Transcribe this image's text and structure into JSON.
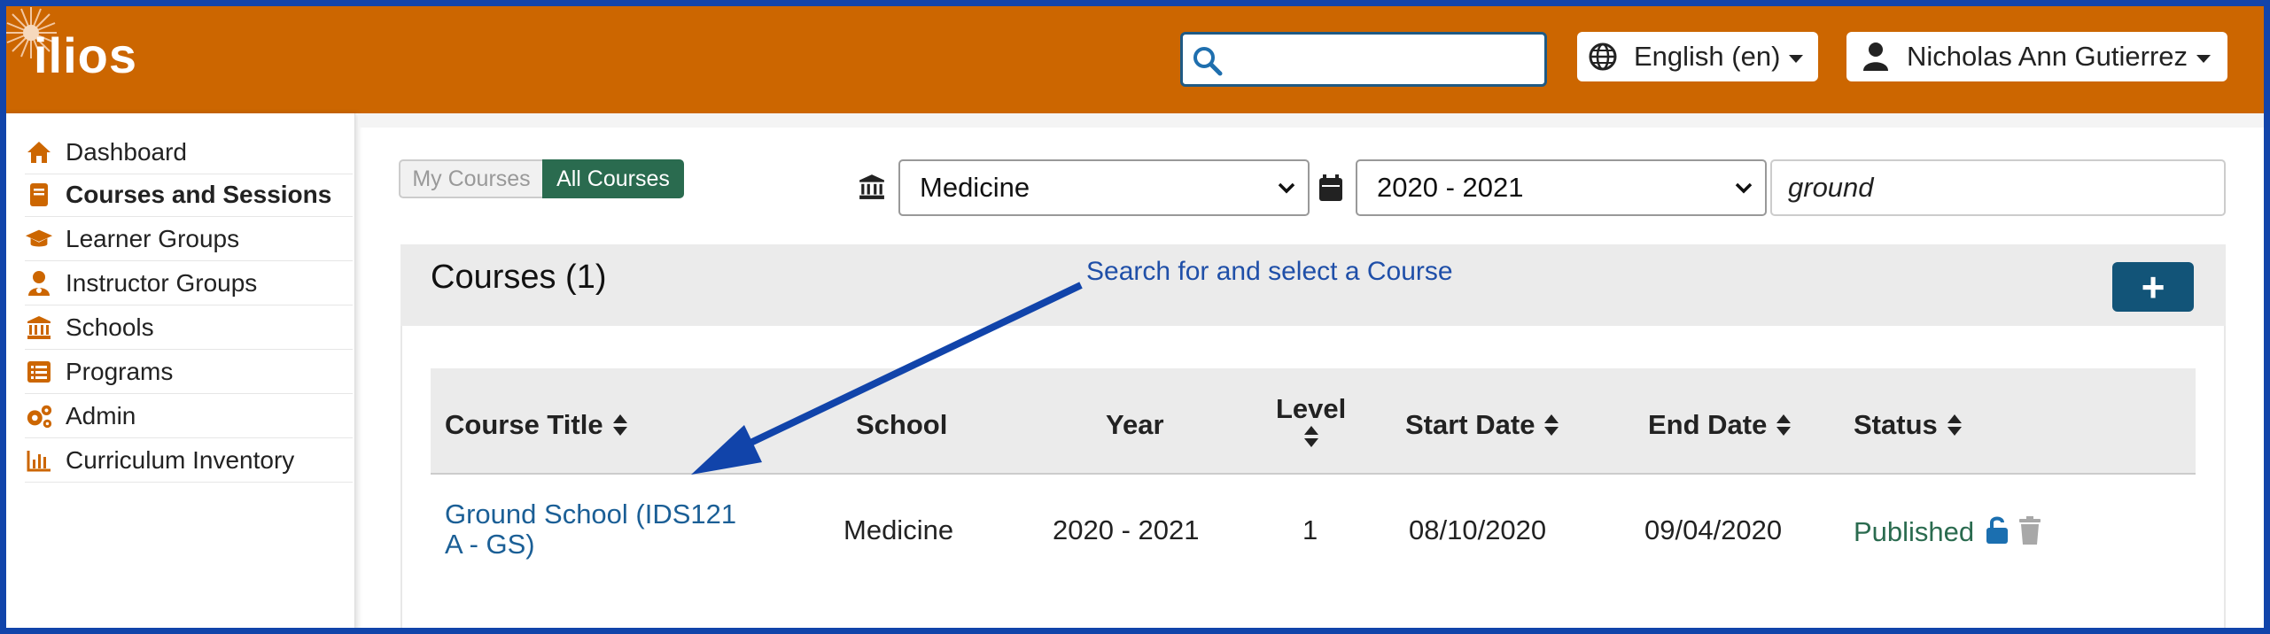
{
  "header": {
    "logo_text": "ilios",
    "search_placeholder": "",
    "language_label": "English (en)",
    "user_label": "Nicholas Ann Gutierrez",
    "brand_color": "#cc6600"
  },
  "sidebar": {
    "items": [
      {
        "label": "Dashboard",
        "icon": "home-icon"
      },
      {
        "label": "Courses and Sessions",
        "icon": "book-icon",
        "active": true
      },
      {
        "label": "Learner Groups",
        "icon": "graduation-cap-icon"
      },
      {
        "label": "Instructor Groups",
        "icon": "user-md-icon"
      },
      {
        "label": "Schools",
        "icon": "university-icon"
      },
      {
        "label": "Programs",
        "icon": "list-alt-icon"
      },
      {
        "label": "Admin",
        "icon": "cogs-icon"
      },
      {
        "label": "Curriculum Inventory",
        "icon": "chart-bar-icon"
      }
    ]
  },
  "filters": {
    "my_courses_label": "My Courses",
    "all_courses_label": "All Courses",
    "school_value": "Medicine",
    "year_value": "2020 - 2021",
    "title_filter_value": "ground"
  },
  "courses": {
    "title": "Courses (1)",
    "add_label": "+",
    "annotation": "Search for and select a Course",
    "columns": [
      "Course Title",
      "School",
      "Year",
      "Level",
      "Start Date",
      "End Date",
      "Status"
    ],
    "rows": [
      {
        "title_line1": "Ground School (IDS121",
        "title_line2": "A - GS)",
        "school": "Medicine",
        "year": "2020 - 2021",
        "level": "1",
        "start_date": "08/10/2020",
        "end_date": "09/04/2020",
        "status": "Published"
      }
    ]
  }
}
